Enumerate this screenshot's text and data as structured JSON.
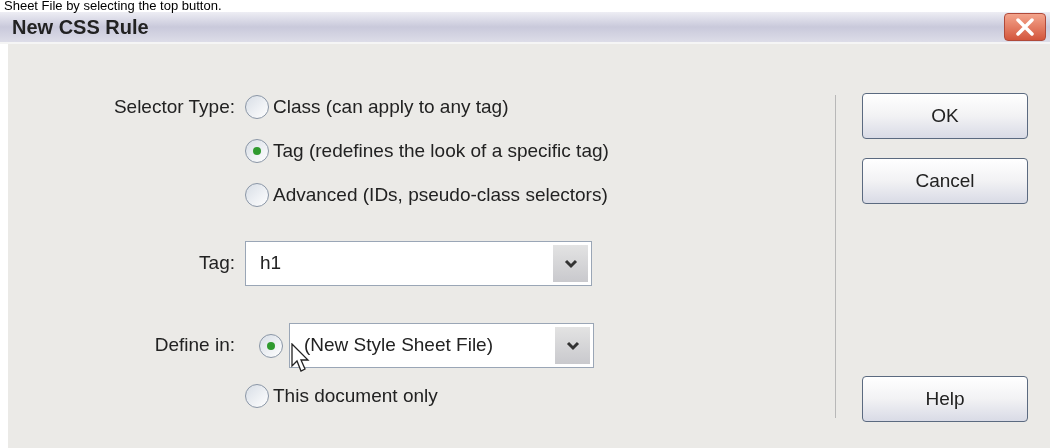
{
  "caption": "Sheet File by selecting the top button.",
  "window": {
    "title": "New CSS Rule"
  },
  "selector_type": {
    "label": "Selector Type:",
    "options": [
      {
        "label": "Class (can apply to any tag)",
        "selected": false
      },
      {
        "label": "Tag (redefines the look of a specific tag)",
        "selected": true
      },
      {
        "label": "Advanced (IDs, pseudo-class selectors)",
        "selected": false
      }
    ]
  },
  "tag": {
    "label": "Tag:",
    "value": "h1"
  },
  "define_in": {
    "label": "Define in:",
    "options": [
      {
        "kind": "combo",
        "value": "(New Style Sheet File)",
        "selected": true
      },
      {
        "kind": "text",
        "label": "This document only",
        "selected": false
      }
    ]
  },
  "buttons": [
    "OK",
    "Cancel",
    "Help"
  ]
}
